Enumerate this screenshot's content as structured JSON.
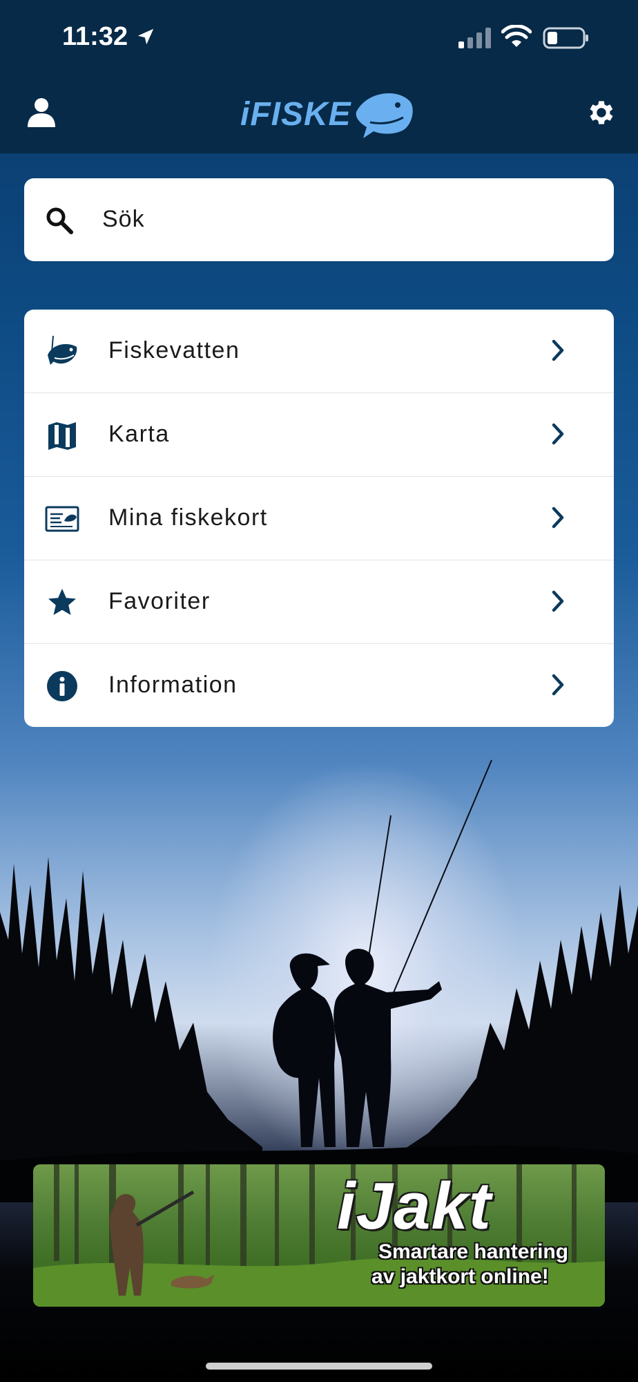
{
  "status_bar": {
    "time": "11:32",
    "icons": [
      "location-arrow-icon",
      "cellular-signal-icon",
      "wifi-icon",
      "battery-icon"
    ]
  },
  "app_bar": {
    "logo_text": "iFISKE",
    "left_icon": "user-icon",
    "right_icon": "gear-icon"
  },
  "search": {
    "placeholder": "Sök",
    "icon": "search-icon"
  },
  "menu": {
    "items": [
      {
        "label": "Fiskevatten",
        "icon": "fish-icon"
      },
      {
        "label": "Karta",
        "icon": "map-icon"
      },
      {
        "label": "Mina fiskekort",
        "icon": "id-card-icon"
      },
      {
        "label": "Favoriter",
        "icon": "star-icon"
      },
      {
        "label": "Information",
        "icon": "info-icon"
      }
    ]
  },
  "ad_banner": {
    "title": "iJakt",
    "line1": "Smartare hantering",
    "line2": "av jaktkort online!"
  },
  "colors": {
    "header_bg": "#062a47",
    "logo": "#6ab0f0",
    "icon": "#0b3a5c",
    "text": "#1a1a1a"
  }
}
